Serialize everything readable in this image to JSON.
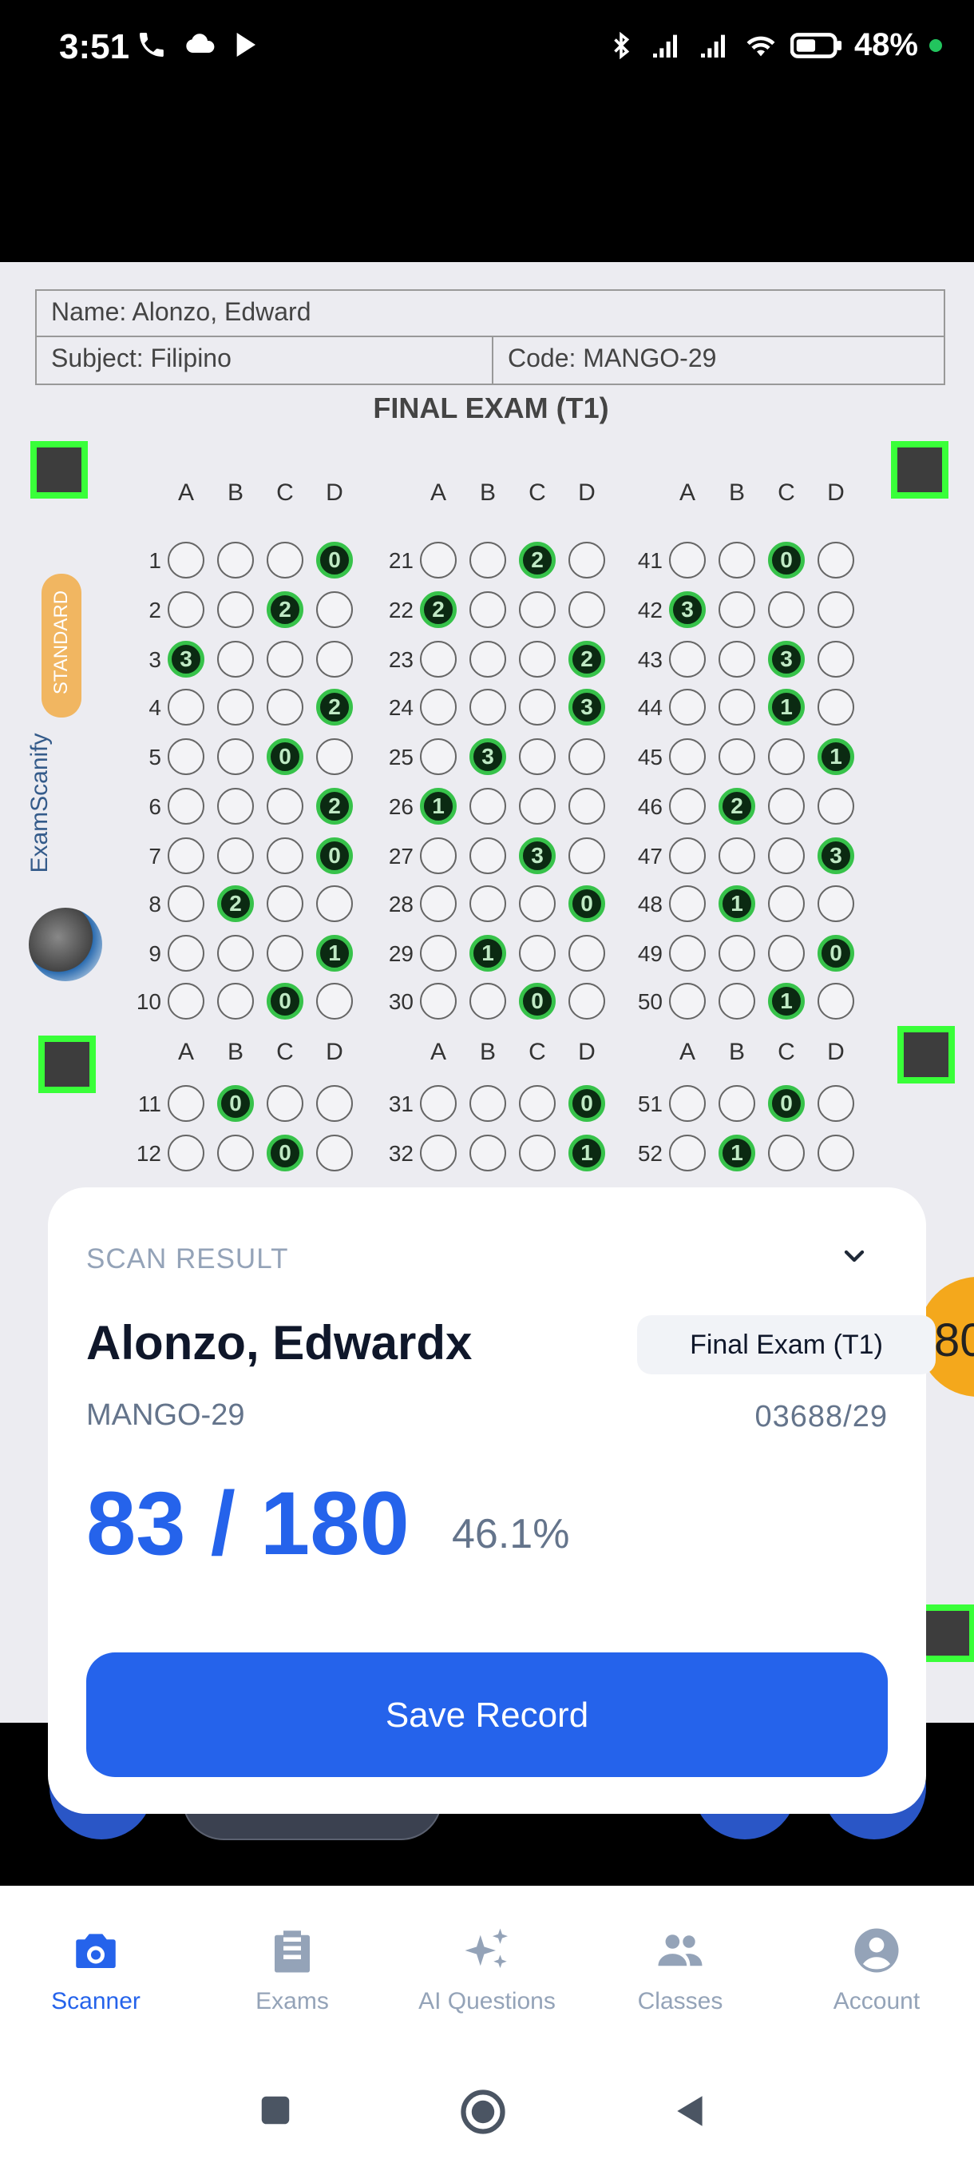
{
  "status_bar": {
    "time": "3:51",
    "battery": "48%"
  },
  "sheet": {
    "name_label": "Name: Alonzo, Edward",
    "subject_label": "Subject: Filipino",
    "code_label": "Code: MANGO-29",
    "title": "FINAL EXAM (T1)",
    "brand_badge": "STANDARD",
    "brand_name": "ExamScanify",
    "column_letters": [
      "A",
      "B",
      "C",
      "D"
    ],
    "question_numbers": [
      "1",
      "2",
      "3",
      "4",
      "5",
      "6",
      "7",
      "8",
      "9",
      "10",
      "11",
      "12",
      "21",
      "22",
      "23",
      "24",
      "25",
      "26",
      "27",
      "28",
      "29",
      "30",
      "31",
      "32",
      "41",
      "42",
      "43",
      "44",
      "45",
      "46",
      "47",
      "48",
      "49",
      "50",
      "51",
      "52"
    ],
    "overlay_score_fragment": "80"
  },
  "result_card": {
    "label": "SCAN RESULT",
    "student_name": "Alonzo, Edwardx",
    "exam_name": "Final Exam (T1)",
    "code": "MANGO-29",
    "id_number": "03688/29",
    "score": "83 / 180",
    "percent": "46.1%",
    "save_label": "Save Record"
  },
  "bottom_nav": {
    "items": [
      {
        "label": "Scanner",
        "icon": "camera-icon",
        "active": true
      },
      {
        "label": "Exams",
        "icon": "clipboard-icon",
        "active": false
      },
      {
        "label": "AI Questions",
        "icon": "sparkles-icon",
        "active": false
      },
      {
        "label": "Classes",
        "icon": "people-icon",
        "active": false
      },
      {
        "label": "Account",
        "icon": "account-circle-icon",
        "active": false
      }
    ]
  },
  "colors": {
    "accent": "#2563eb",
    "marker": "#39ff39",
    "filled_bubble_ring": "#37c24a"
  }
}
